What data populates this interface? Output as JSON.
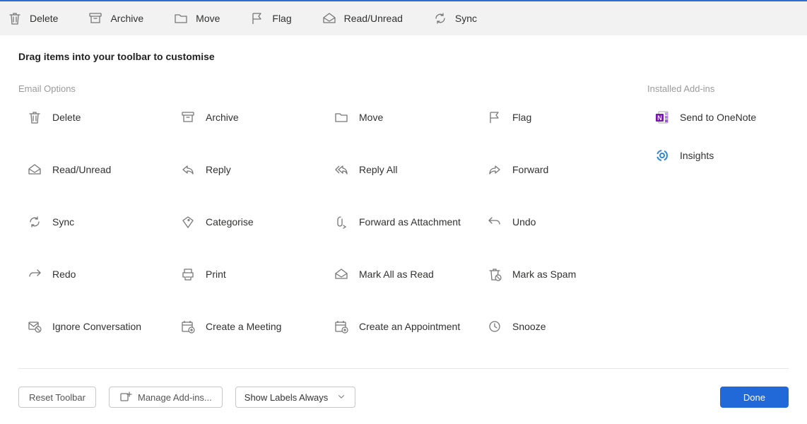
{
  "toolbar": [
    {
      "id": "delete",
      "label": "Delete",
      "icon": "trash"
    },
    {
      "id": "archive",
      "label": "Archive",
      "icon": "archive"
    },
    {
      "id": "move",
      "label": "Move",
      "icon": "folder"
    },
    {
      "id": "flag",
      "label": "Flag",
      "icon": "flag"
    },
    {
      "id": "readunread",
      "label": "Read/Unread",
      "icon": "envelope"
    },
    {
      "id": "sync",
      "label": "Sync",
      "icon": "sync"
    }
  ],
  "instruction": "Drag items into your toolbar to customise",
  "sections": {
    "email_options": {
      "title": "Email Options",
      "items": [
        {
          "id": "delete",
          "label": "Delete",
          "icon": "trash"
        },
        {
          "id": "archive",
          "label": "Archive",
          "icon": "archive"
        },
        {
          "id": "move",
          "label": "Move",
          "icon": "folder"
        },
        {
          "id": "flag",
          "label": "Flag",
          "icon": "flag"
        },
        {
          "id": "readunread",
          "label": "Read/Unread",
          "icon": "envelope"
        },
        {
          "id": "reply",
          "label": "Reply",
          "icon": "reply"
        },
        {
          "id": "replyall",
          "label": "Reply All",
          "icon": "replyall"
        },
        {
          "id": "forward",
          "label": "Forward",
          "icon": "forward"
        },
        {
          "id": "sync",
          "label": "Sync",
          "icon": "sync"
        },
        {
          "id": "categorise",
          "label": "Categorise",
          "icon": "tag"
        },
        {
          "id": "forwardattach",
          "label": "Forward as Attachment",
          "icon": "attachfwd"
        },
        {
          "id": "undo",
          "label": "Undo",
          "icon": "undo"
        },
        {
          "id": "redo",
          "label": "Redo",
          "icon": "redo"
        },
        {
          "id": "print",
          "label": "Print",
          "icon": "print"
        },
        {
          "id": "markallread",
          "label": "Mark All as Read",
          "icon": "envelope"
        },
        {
          "id": "markspam",
          "label": "Mark as Spam",
          "icon": "spam"
        },
        {
          "id": "ignore",
          "label": "Ignore Conversation",
          "icon": "ignore"
        },
        {
          "id": "meeting",
          "label": "Create a Meeting",
          "icon": "calmeet"
        },
        {
          "id": "appointment",
          "label": "Create an Appointment",
          "icon": "calappt"
        },
        {
          "id": "snooze",
          "label": "Snooze",
          "icon": "clock"
        }
      ]
    },
    "addins": {
      "title": "Installed Add-ins",
      "items": [
        {
          "id": "onenote",
          "label": "Send to OneNote",
          "icon": "onenote"
        },
        {
          "id": "insights",
          "label": "Insights",
          "icon": "insights"
        }
      ]
    }
  },
  "footer": {
    "reset": "Reset Toolbar",
    "manage_addins": "Manage Add-ins...",
    "show_labels": "Show Labels Always",
    "done": "Done"
  }
}
